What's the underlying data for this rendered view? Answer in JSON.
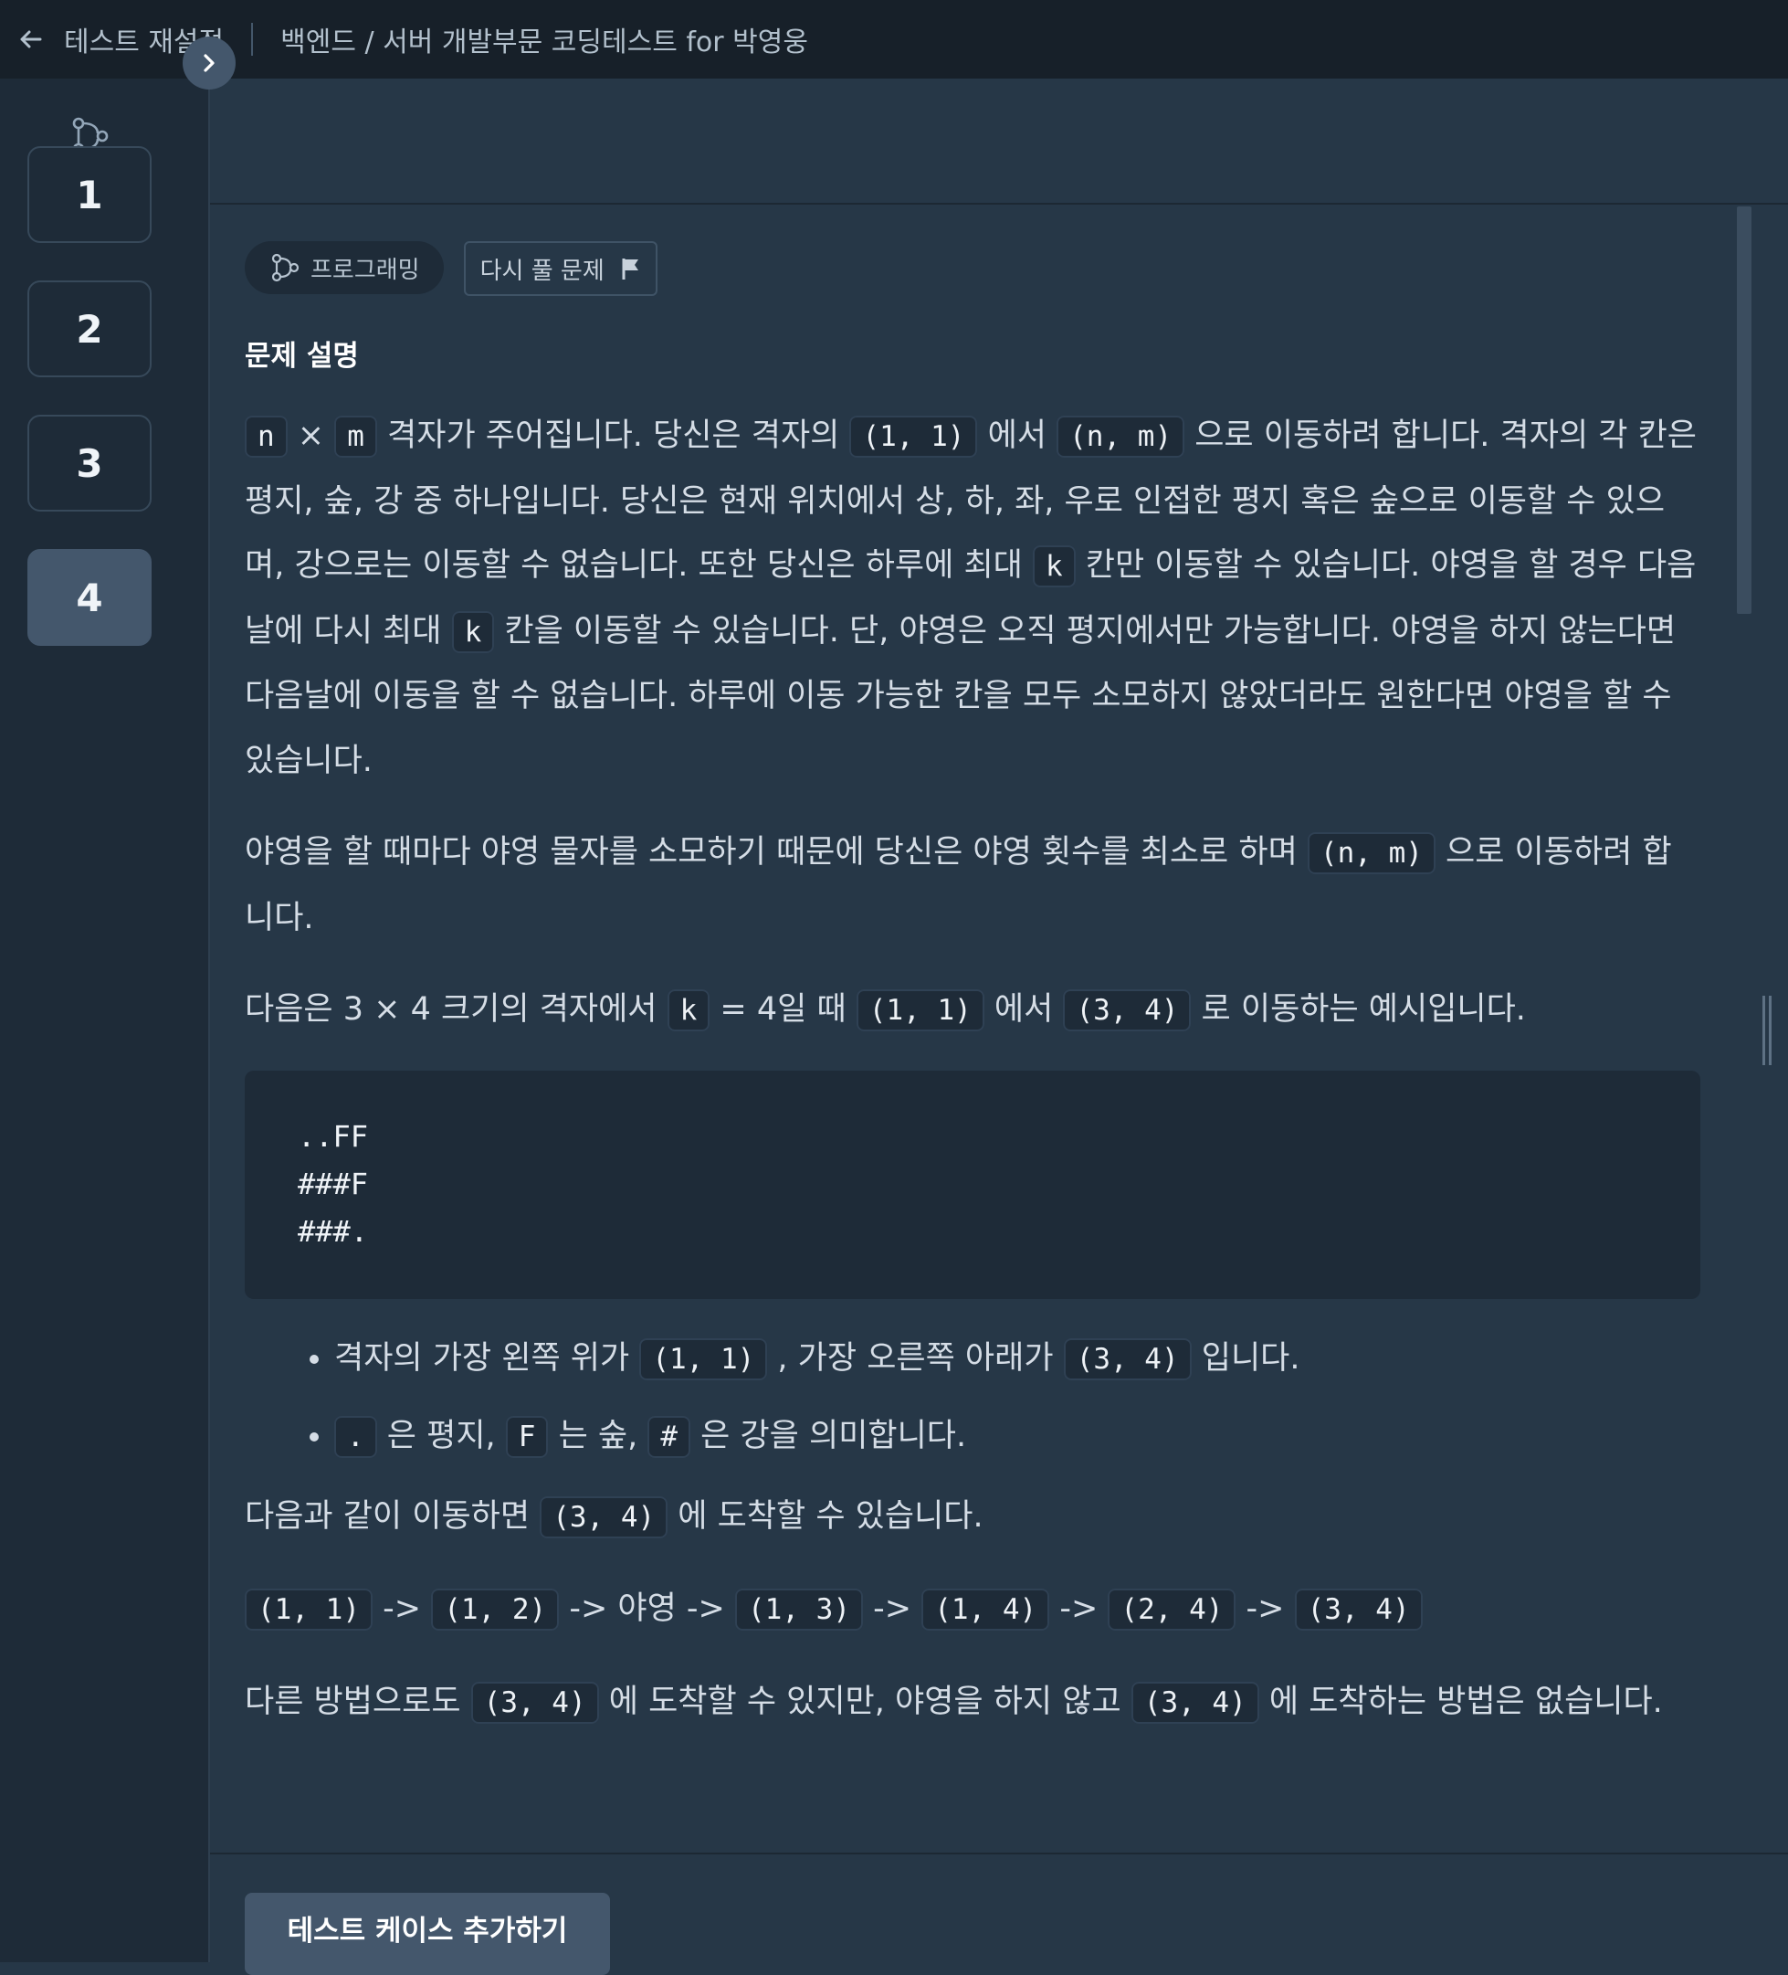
{
  "topbar": {
    "back_label": "테스트 재설정",
    "title": "백엔드 / 서버 개발부문 코딩테스트 for 박영웅"
  },
  "sidebar": {
    "icon": "code-branch-icon",
    "questions": [
      "1",
      "2",
      "3",
      "4"
    ],
    "active_index": 3
  },
  "expand_icon": "chevron-right-icon",
  "chips": {
    "category": "프로그래밍",
    "retry": "다시 풀 문제",
    "retry_icon": "flag-icon"
  },
  "problem": {
    "heading": "문제 설명",
    "p1": [
      {
        "c": "n"
      },
      {
        "t": " × "
      },
      {
        "c": "m"
      },
      {
        "t": " 격자가 주어집니다. 당신은 격자의 "
      },
      {
        "c": "(1, 1)"
      },
      {
        "t": " 에서 "
      },
      {
        "c": "(n, m)"
      },
      {
        "t": " 으로 이동하려 합니다. 격자의 각 칸은 평지, 숲, 강 중 하나입니다. 당신은 현재 위치에서 상, 하, 좌, 우로 인접한 평지 혹은 숲으로 이동할 수 있으며, 강으로는 이동할 수 없습니다. 또한 당신은 하루에 최대 "
      },
      {
        "c": "k"
      },
      {
        "t": " 칸만 이동할 수 있습니다. 야영을 할 경우 다음날에 다시 최대 "
      },
      {
        "c": "k"
      },
      {
        "t": " 칸을 이동할 수 있습니다. 단, 야영은 오직 평지에서만 가능합니다. 야영을 하지 않는다면 다음날에 이동을 할 수 없습니다. 하루에 이동 가능한 칸을 모두 소모하지 않았더라도 원한다면 야영을 할 수 있습니다."
      }
    ],
    "p2": [
      {
        "t": "야영을 할 때마다 야영 물자를 소모하기 때문에 당신은 야영 횟수를 최소로 하며 "
      },
      {
        "c": "(n, m)"
      },
      {
        "t": " 으로 이동하려 합니다."
      }
    ],
    "p3": [
      {
        "t": "다음은 3 × 4 크기의 격자에서 "
      },
      {
        "c": "k"
      },
      {
        "t": " = 4일 때 "
      },
      {
        "c": "(1, 1)"
      },
      {
        "t": " 에서 "
      },
      {
        "c": "(3, 4)"
      },
      {
        "t": " 로 이동하는 예시입니다."
      }
    ],
    "grid_example": "..FF\n###F\n###.",
    "bullets": [
      [
        {
          "t": "격자의 가장 왼쪽 위가 "
        },
        {
          "c": "(1, 1)"
        },
        {
          "t": " , 가장 오른쪽 아래가 "
        },
        {
          "c": "(3, 4)"
        },
        {
          "t": " 입니다."
        }
      ],
      [
        {
          "c": "."
        },
        {
          "t": " 은 평지, "
        },
        {
          "c": "F"
        },
        {
          "t": " 는 숲, "
        },
        {
          "c": "#"
        },
        {
          "t": " 은 강을 의미합니다."
        }
      ]
    ],
    "p4": [
      {
        "t": "다음과 같이 이동하면 "
      },
      {
        "c": "(3, 4)"
      },
      {
        "t": " 에 도착할 수 있습니다."
      }
    ],
    "p5": [
      {
        "c": "(1, 1)"
      },
      {
        "t": " -> "
      },
      {
        "c": "(1, 2)"
      },
      {
        "t": " -> 야영 -> "
      },
      {
        "c": "(1, 3)"
      },
      {
        "t": " -> "
      },
      {
        "c": "(1, 4)"
      },
      {
        "t": " -> "
      },
      {
        "c": "(2, 4)"
      },
      {
        "t": " -> "
      },
      {
        "c": "(3, 4)"
      }
    ],
    "p6": [
      {
        "t": "다른 방법으로도 "
      },
      {
        "c": "(3, 4)"
      },
      {
        "t": " 에 도착할 수 있지만, 야영을 하지 않고 "
      },
      {
        "c": "(3, 4)"
      },
      {
        "t": " 에 도착하는 방법은 없습니다."
      }
    ]
  },
  "footer": {
    "add_testcase_label": "테스트 케이스 추가하기"
  }
}
